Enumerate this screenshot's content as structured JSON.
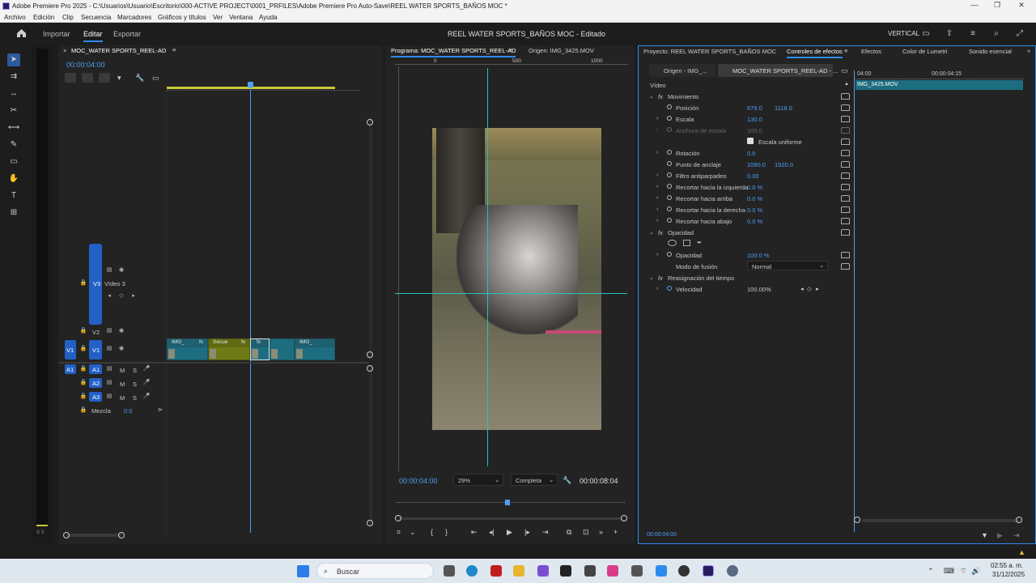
{
  "window": {
    "title": "Adobe Premiere Pro 2025 - C:\\Usuarios\\Usuario\\Escritorio\\000-ACTIVE PROJECT\\0001_PRFILES\\Adobe Premiere Pro Auto-Save\\REEL WATER SPORTS_BAÑOS MOC *",
    "minimize": "—",
    "maximize": "❐",
    "close": "✕"
  },
  "menu": [
    "Archivo",
    "Edición",
    "Clip",
    "Secuencia",
    "Marcadores",
    "Gráficos y títulos",
    "Ver",
    "Ventana",
    "Ayuda"
  ],
  "header": {
    "tabs": [
      "Importar",
      "Editar",
      "Exportar"
    ],
    "project_title": "REEL WATER SPORTS_BAÑOS MOC - Editado",
    "workspace": "VERTICAL"
  },
  "timeline": {
    "tab": "MOC_WATER SPORTS_REEL-AD",
    "timecode": "00:00:04:00",
    "tracks": {
      "v3": "V3",
      "v3_name": "Vídeo 3",
      "v2": "V2",
      "v1_src": "V1",
      "v1": "V1",
      "a1_src": "A1",
      "a1": "A1",
      "a2": "A2",
      "a3": "A3",
      "m": "M",
      "s": "S",
      "mix_label": "Mezcla",
      "mix_value": "0.0"
    },
    "clips": [
      {
        "label": "IMG_",
        "fx": "fx"
      },
      {
        "label": "Secue",
        "fx": "fx"
      },
      {
        "label": "",
        "fx": "fx"
      },
      {
        "label": "IMG_",
        "fx": "fx"
      }
    ],
    "meter_label": "S S"
  },
  "program": {
    "tab_active": "Programa: MOC_WATER SPORTS_REEL-AD",
    "tab_other": "Origen: IMG_3425.MOV",
    "ruler": [
      "0",
      "500",
      "1000"
    ],
    "timecode": "00:00:04:00",
    "zoom": "29%",
    "quality": "Completa",
    "duration": "00:00:08:04"
  },
  "effects": {
    "tabs": [
      "Proyecto: REEL WATER SPORTS_BAÑOS MOC",
      "Controles de efectos",
      "Efectos",
      "Color de Lumetri",
      "Sonido esencial"
    ],
    "source_tab": "Origen - IMG_...",
    "seq_tab": "MOC_WATER SPORTS_REEL-AD - ...",
    "section_video": "Vídeo",
    "motion": "Movimiento",
    "props": [
      {
        "label": "Posición",
        "v1": "679.0",
        "v2": "1118.0"
      },
      {
        "label": "Escala",
        "v1": "130.0",
        "v2": ""
      },
      {
        "label": "Anchura de escala",
        "v1": "100.0",
        "v2": ""
      },
      {
        "label": "Escala uniforme",
        "v1": "",
        "v2": ""
      },
      {
        "label": "Rotación",
        "v1": "0.0",
        "v2": ""
      },
      {
        "label": "Punto de anclaje",
        "v1": "1080.0",
        "v2": "1920.0"
      },
      {
        "label": "Filtro antiparpadeo",
        "v1": "0.00",
        "v2": ""
      },
      {
        "label": "Recortar hacia la izquierda",
        "v1": "0.0 %",
        "v2": ""
      },
      {
        "label": "Recortar hacia arriba",
        "v1": "0.0 %",
        "v2": ""
      },
      {
        "label": "Recortar hacia la derecha",
        "v1": "0.0 %",
        "v2": ""
      },
      {
        "label": "Recortar hacia abajo",
        "v1": "0.0 %",
        "v2": ""
      }
    ],
    "opacity_section": "Opacidad",
    "opacity_label": "Opacidad",
    "opacity_value": "100.0 %",
    "blend_label": "Modo de fusión",
    "blend_value": "Normal",
    "remap_section": "Reasignación del tiempo",
    "speed_label": "Velocidad",
    "speed_value": "100.00%",
    "mini_ruler": [
      "04:00",
      "00:00:04:15"
    ],
    "mini_clip": "IMG_3425.MOV",
    "footer_timecode": "00:00:04:00"
  },
  "taskbar": {
    "search": "Buscar",
    "time": "02:55 a. m.",
    "date": "31/12/2025"
  }
}
